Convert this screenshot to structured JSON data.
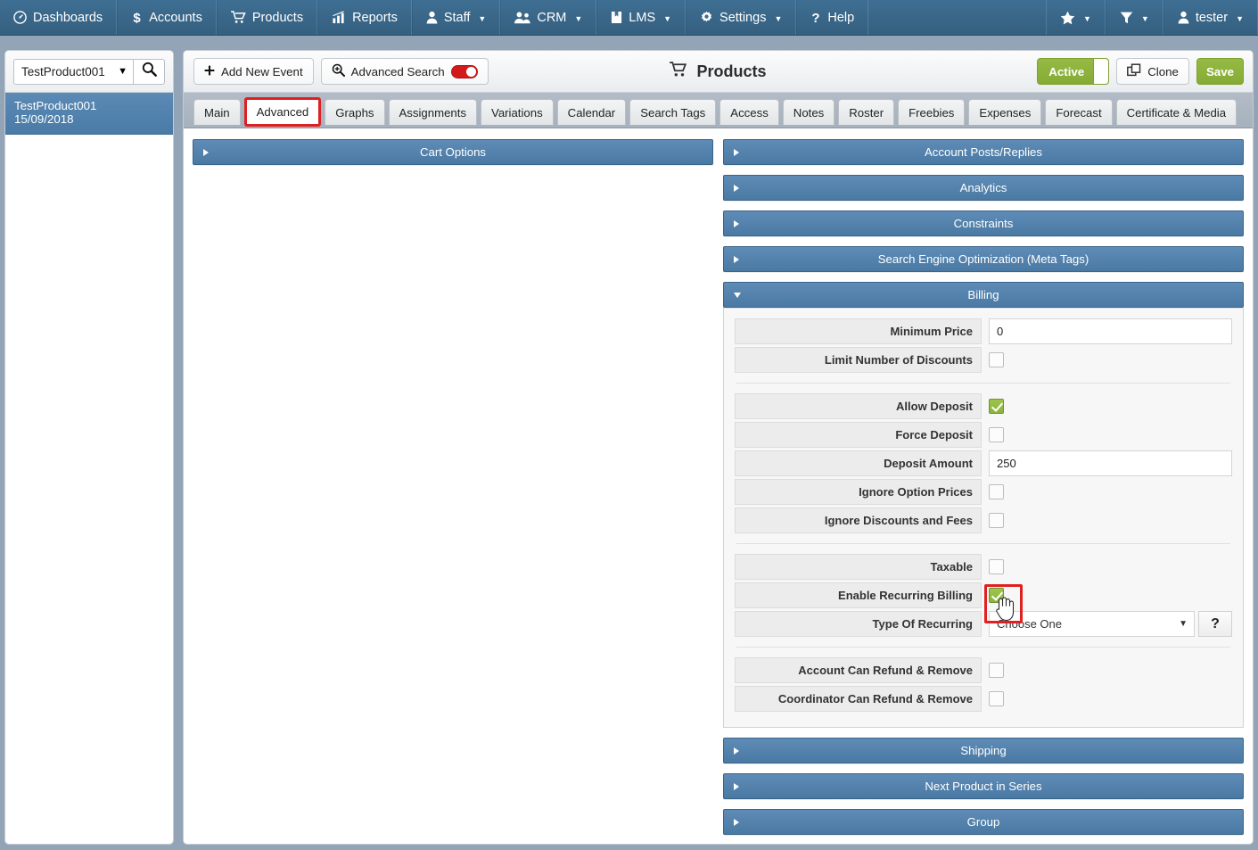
{
  "topnav": {
    "items": [
      {
        "label": "Dashboards",
        "icon": "dashboard-icon",
        "caret": false
      },
      {
        "label": "Accounts",
        "icon": "dollar-icon",
        "caret": false
      },
      {
        "label": "Products",
        "icon": "cart-icon",
        "caret": false
      },
      {
        "label": "Reports",
        "icon": "chart-icon",
        "caret": false
      },
      {
        "label": "Staff",
        "icon": "person-icon",
        "caret": true
      },
      {
        "label": "CRM",
        "icon": "people-icon",
        "caret": true
      },
      {
        "label": "LMS",
        "icon": "book-icon",
        "caret": true
      },
      {
        "label": "Settings",
        "icon": "gear-icon",
        "caret": true
      },
      {
        "label": "Help",
        "icon": "question-icon",
        "caret": false
      }
    ],
    "right": [
      {
        "label": "",
        "icon": "star-icon",
        "caret": true
      },
      {
        "label": "",
        "icon": "funnel-icon",
        "caret": true
      },
      {
        "label": "tester",
        "icon": "person-icon",
        "caret": true
      }
    ]
  },
  "sidebar": {
    "search": {
      "selected": "TestProduct001",
      "search_icon": "search-icon",
      "caret": "▼"
    },
    "results": [
      {
        "name": "TestProduct001",
        "date": "15/09/2018",
        "selected": true
      }
    ]
  },
  "toolbar": {
    "add_new_event": "Add New Event",
    "advanced_search": "Advanced Search",
    "advanced_search_on": true,
    "page_title": "Products",
    "active_label": "Active",
    "clone_label": "Clone",
    "save_label": "Save"
  },
  "tabs": [
    {
      "label": "Main",
      "selected": false
    },
    {
      "label": "Advanced",
      "selected": true
    },
    {
      "label": "Graphs",
      "selected": false
    },
    {
      "label": "Assignments",
      "selected": false
    },
    {
      "label": "Variations",
      "selected": false
    },
    {
      "label": "Calendar",
      "selected": false
    },
    {
      "label": "Search Tags",
      "selected": false
    },
    {
      "label": "Access",
      "selected": false
    },
    {
      "label": "Notes",
      "selected": false
    },
    {
      "label": "Roster",
      "selected": false
    },
    {
      "label": "Freebies",
      "selected": false
    },
    {
      "label": "Expenses",
      "selected": false
    },
    {
      "label": "Forecast",
      "selected": false
    },
    {
      "label": "Certificate & Media",
      "selected": false
    }
  ],
  "left_panels": [
    {
      "title": "Cart Options",
      "expanded": false
    }
  ],
  "right_panels_top": [
    {
      "title": "Account Posts/Replies",
      "expanded": false
    },
    {
      "title": "Analytics",
      "expanded": false
    },
    {
      "title": "Constraints",
      "expanded": false
    },
    {
      "title": "Search Engine Optimization (Meta Tags)",
      "expanded": false
    }
  ],
  "billing": {
    "title": "Billing",
    "expanded": true,
    "group1": [
      {
        "label": "Minimum Price",
        "type": "text",
        "value": "0"
      },
      {
        "label": "Limit Number of Discounts",
        "type": "checkbox",
        "checked": false
      }
    ],
    "group2": [
      {
        "label": "Allow Deposit",
        "type": "checkbox",
        "checked": true
      },
      {
        "label": "Force Deposit",
        "type": "checkbox",
        "checked": false
      },
      {
        "label": "Deposit Amount",
        "type": "text",
        "value": "250"
      },
      {
        "label": "Ignore Option Prices",
        "type": "checkbox",
        "checked": false
      },
      {
        "label": "Ignore Discounts and Fees",
        "type": "checkbox",
        "checked": false
      }
    ],
    "group3": [
      {
        "label": "Taxable",
        "type": "checkbox",
        "checked": false
      },
      {
        "label": "Enable Recurring Billing",
        "type": "checkbox",
        "checked": true,
        "highlighted": true
      },
      {
        "label": "Type Of Recurring",
        "type": "select",
        "value": "Choose One",
        "help": "?"
      }
    ],
    "group4": [
      {
        "label": "Account Can Refund & Remove",
        "type": "checkbox",
        "checked": false
      },
      {
        "label": "Coordinator Can Refund & Remove",
        "type": "checkbox",
        "checked": false
      }
    ]
  },
  "right_panels_bottom": [
    {
      "title": "Shipping",
      "expanded": false
    },
    {
      "title": "Next Product in Series",
      "expanded": false
    },
    {
      "title": "Group",
      "expanded": false
    }
  ],
  "colors": {
    "nav_blue": "#3e6f93",
    "panel_blue": "#5e8cb6",
    "accent_green": "#8bb43c",
    "highlight_red": "#e02020",
    "page_bg": "#93a4b7"
  }
}
